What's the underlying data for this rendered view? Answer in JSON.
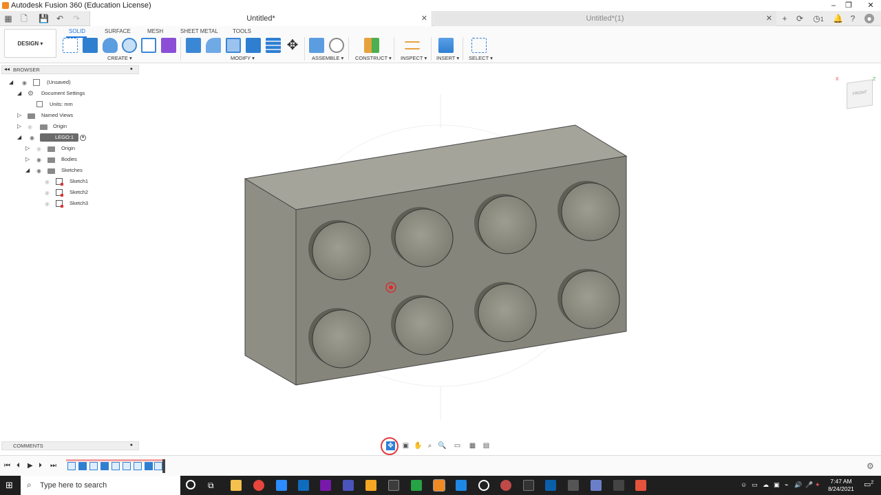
{
  "window": {
    "title": "Autodesk Fusion 360 (Education License)"
  },
  "tabs": [
    {
      "label": "Untitled*"
    },
    {
      "label": "Untitled*(1)"
    }
  ],
  "appbar": {
    "notification_count": "1"
  },
  "ribbon": {
    "workspace": "DESIGN",
    "tabs": [
      "SOLID",
      "SURFACE",
      "MESH",
      "SHEET METAL",
      "TOOLS"
    ],
    "groups": [
      "CREATE",
      "MODIFY",
      "ASSEMBLE",
      "CONSTRUCT",
      "INSPECT",
      "INSERT",
      "SELECT"
    ]
  },
  "browser": {
    "title": "BROWSER",
    "items": [
      {
        "label": "(Unsaved)"
      },
      {
        "label": "Document Settings"
      },
      {
        "label": "Units: mm"
      },
      {
        "label": "Named Views"
      },
      {
        "label": "Origin"
      },
      {
        "label": "LEGO:1"
      },
      {
        "label": "Origin"
      },
      {
        "label": "Bodies"
      },
      {
        "label": "Sketches"
      },
      {
        "label": "Sketch1"
      },
      {
        "label": "Sketch2"
      },
      {
        "label": "Sketch3"
      }
    ]
  },
  "viewcube": {
    "face": "FRONT",
    "axis_x": "X",
    "axis_z": "Z"
  },
  "comments": {
    "title": "COMMENTS"
  },
  "taskbar": {
    "search_placeholder": "Type here to search",
    "time": "7:47 AM",
    "date": "8/24/2021",
    "notifications": "2"
  }
}
